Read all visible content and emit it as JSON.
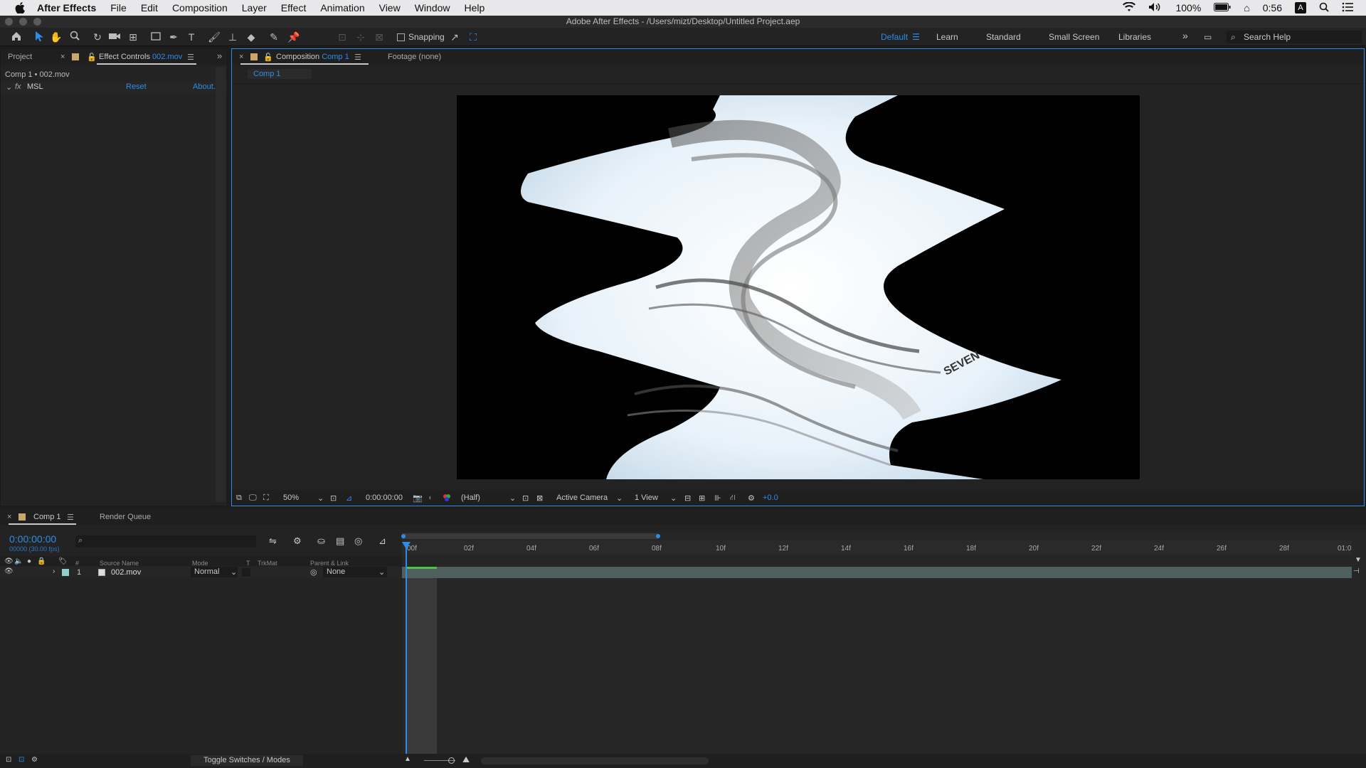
{
  "menubar": {
    "app": "After Effects",
    "items": [
      "File",
      "Edit",
      "Composition",
      "Layer",
      "Effect",
      "Animation",
      "View",
      "Window",
      "Help"
    ],
    "battery": "100%",
    "time": "0:56"
  },
  "window": {
    "title": "Adobe After Effects - /Users/mizt/Desktop/Untitled Project.aep"
  },
  "toolbar": {
    "snapping": "Snapping",
    "workspaces": [
      "Default",
      "Learn",
      "Standard",
      "Small Screen",
      "Libraries"
    ],
    "active_workspace": "Default",
    "search_placeholder": "Search Help"
  },
  "left_panel": {
    "tab_project": "Project",
    "tab_effect_controls_prefix": "Effect Controls",
    "tab_effect_controls_file": "002.mov",
    "breadcrumb": "Comp 1 • 002.mov",
    "effect": {
      "fx": "fx",
      "name": "MSL",
      "reset": "Reset",
      "about": "About."
    }
  },
  "comp_panel": {
    "tab_prefix": "Composition",
    "tab_comp": "Comp 1",
    "tab_footage": "Footage (none)",
    "breadcrumb": "Comp 1",
    "viewer_bar": {
      "zoom": "50%",
      "timecode": "0:00:00:00",
      "resolution": "(Half)",
      "camera": "Active Camera",
      "views": "1 View",
      "exposure": "+0.0"
    },
    "footage_text": "SEVEN"
  },
  "timeline": {
    "tab_comp": "Comp 1",
    "tab_render": "Render Queue",
    "timecode": "0:00:00:00",
    "frame_info": "00000 (30.00 fps)",
    "columns": {
      "num": "#",
      "source": "Source Name",
      "mode": "Mode",
      "t": "T",
      "trkmat": "TrkMat",
      "parent": "Parent & Link"
    },
    "layer": {
      "index": "1",
      "name": "002.mov",
      "mode": "Normal",
      "parent": "None"
    },
    "ruler": [
      "00f",
      "02f",
      "04f",
      "06f",
      "08f",
      "10f",
      "12f",
      "14f",
      "16f",
      "18f",
      "20f",
      "22f",
      "24f",
      "26f",
      "28f",
      "01:0"
    ],
    "toggle_label": "Toggle Switches / Modes"
  }
}
